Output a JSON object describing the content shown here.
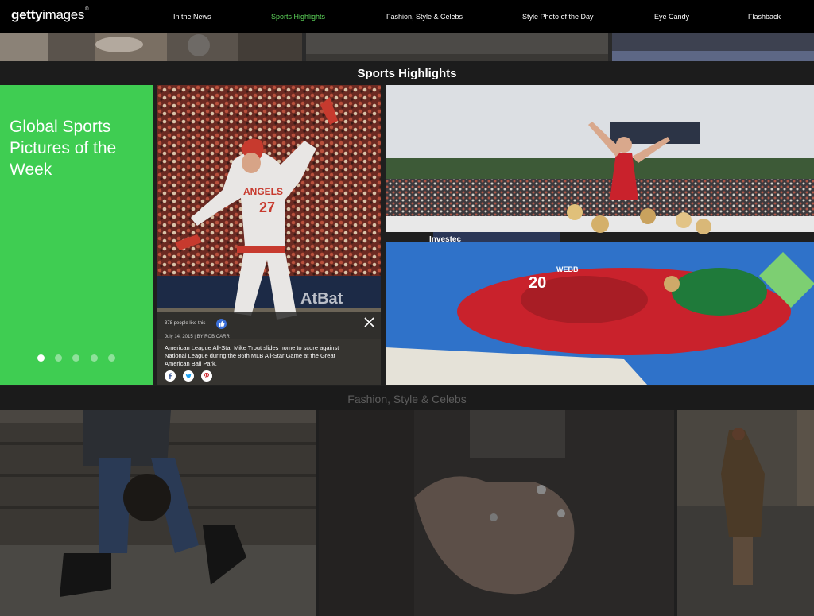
{
  "header": {
    "logo_bold": "getty",
    "logo_light": "images",
    "logo_mark": "®",
    "nav": [
      {
        "label": "In the News",
        "active": false
      },
      {
        "label": "Sports Highlights",
        "active": true
      },
      {
        "label": "Fashion, Style & Celebs",
        "active": false
      },
      {
        "label": "Style Photo of the Day",
        "active": false
      },
      {
        "label": "Eye Candy",
        "active": false
      },
      {
        "label": "Flashback",
        "active": false
      }
    ]
  },
  "section": {
    "title": "Sports Highlights"
  },
  "promo": {
    "title": "Global Sports Pictures of the Week",
    "slides_total": 5,
    "slide_active": 1
  },
  "caption": {
    "likes": "378 people like this",
    "date_credit": "July 14, 2015 | BY ROB CARR",
    "text": "American League All-Star Mike Trout slides home to score against National League during the 86th MLB All-Star Game at the Great American Ball Park."
  },
  "photo1": {
    "banner_text": "AtBat",
    "jersey_name": "ANGELS",
    "jersey_number": "27"
  },
  "photo2": {
    "board_text": "Investec",
    "jersey_number": "20",
    "jersey_name": "WEBB"
  },
  "next_section": {
    "title": "Fashion, Style & Celebs"
  },
  "colors": {
    "accent_green": "#3fcd52",
    "nav_active": "#5ed65b",
    "like_blue": "#3b6fd8",
    "hockey_turf": "#2f72c9",
    "hockey_kit": "#c9222c"
  }
}
